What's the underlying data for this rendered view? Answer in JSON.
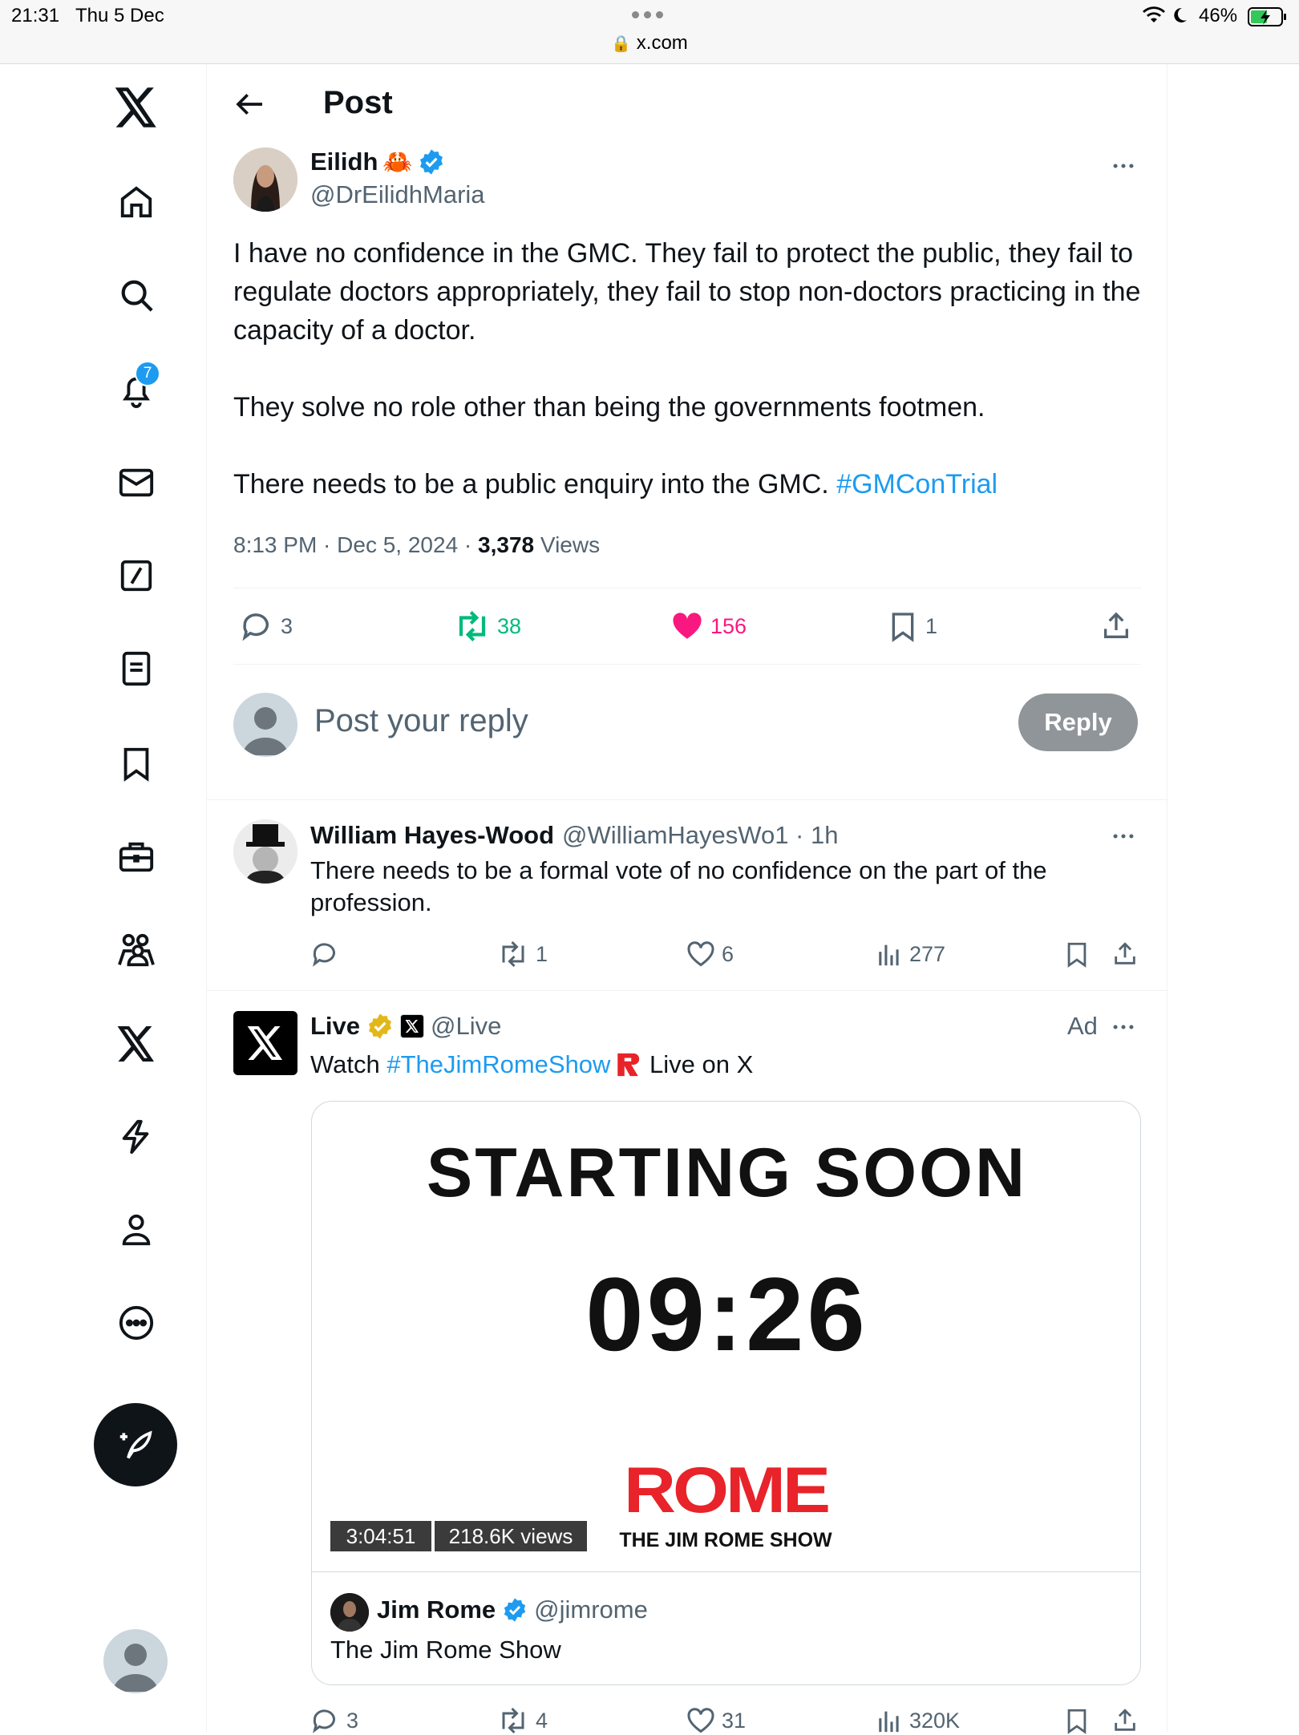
{
  "status_bar": {
    "time": "21:31",
    "date": "Thu 5 Dec",
    "url": "x.com",
    "battery": "46%"
  },
  "sidebar": {
    "notification_count": "7",
    "items": [
      "home-icon",
      "search-icon",
      "bell-icon",
      "mail-icon",
      "grok-icon",
      "lists-icon",
      "bookmark-icon",
      "jobs-icon",
      "communities-icon",
      "x-premium-icon",
      "verified-orgs-icon",
      "profile-icon",
      "more-icon"
    ]
  },
  "header": {
    "title": "Post"
  },
  "main_tweet": {
    "name": "Eilidh",
    "emoji": "🦀",
    "handle": "@DrEilidhMaria",
    "text": "I have no confidence in the GMC. They fail to protect the public, they fail to regulate doctors appropriately, they fail to stop non-doctors practicing in the capacity of a doctor.\n\nThey solve no role other than being the governments footmen.\n\nThere needs to be a public enquiry into the GMC. ",
    "hashtag": "#GMConTrial",
    "timestamp": "8:13 PM · Dec 5, 2024 · ",
    "views_count": "3,378",
    "views_label": " Views",
    "replies": "3",
    "reposts": "38",
    "likes": "156",
    "bookmarks": "1"
  },
  "reply_box": {
    "placeholder": "Post your reply",
    "button": "Reply"
  },
  "reply_tweet": {
    "name": "William Hayes-Wood",
    "handle": "@WilliamHayesWo1 · 1h",
    "text": "There needs to be a formal vote of no confidence on the part of the profession.",
    "reposts": "1",
    "likes": "6",
    "views": "277"
  },
  "ad_tweet": {
    "name": "Live",
    "handle": "@Live",
    "ad_label": "Ad",
    "text_prefix": "Watch ",
    "hashtag": "#TheJimRomeShow",
    "text_suffix": " Live on X",
    "media": {
      "headline": "STARTING SOON",
      "countdown": "09:26",
      "brand": "ROME",
      "brand_sub": "THE JIM ROME SHOW",
      "duration": "3:04:51",
      "views": "218.6K views"
    },
    "quote": {
      "name": "Jim Rome",
      "handle": "@jimrome",
      "text": "The Jim Rome Show"
    },
    "replies": "3",
    "reposts": "4",
    "likes": "31",
    "views": "320K"
  },
  "colors": {
    "accent": "#1d9bf0",
    "like": "#f91880",
    "repost": "#00ba7c",
    "rome_red": "#e8232a"
  }
}
